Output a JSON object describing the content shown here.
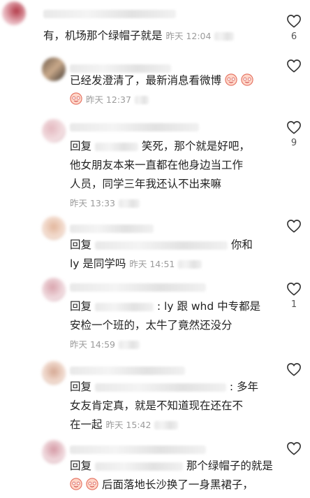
{
  "comments": [
    {
      "text": "有，机场那个绿帽子就是",
      "time": "昨天 12:04",
      "likes": "6"
    },
    {
      "text": "已经发澄清了，最新消息看微博",
      "time": "昨天 12:37",
      "likes": ""
    },
    {
      "reply": "回复",
      "text": "笑死，那个就是好吧，",
      "line2": "他女朋友本来一直都在他身边当工作",
      "line3": "人员，同学三年我还认不出来嘛",
      "time": "昨天 13:33",
      "likes": "9"
    },
    {
      "reply": "回复",
      "text": "你和",
      "line2": "ly 是同学吗",
      "time": "昨天 14:51",
      "likes": ""
    },
    {
      "reply": "回复",
      "text": ": ly 跟 whd 中专都是",
      "line2": "安检一个班的，太牛了竟然还没分",
      "time": "昨天 14:59",
      "likes": "1"
    },
    {
      "reply": "回复",
      "text": ": 多年",
      "line2": "女友肯定真，就是不知道现在还在不",
      "line3": "在一起",
      "time": "昨天 15:42",
      "likes": ""
    },
    {
      "reply": "回复",
      "text": "那个绿帽子的就是",
      "line2": "后面落地长沙换了一身黑裙子，",
      "likes": ""
    }
  ],
  "icons": {
    "heart": "heart-outline-icon",
    "emoji": "smiling-face-emoji-icon"
  }
}
